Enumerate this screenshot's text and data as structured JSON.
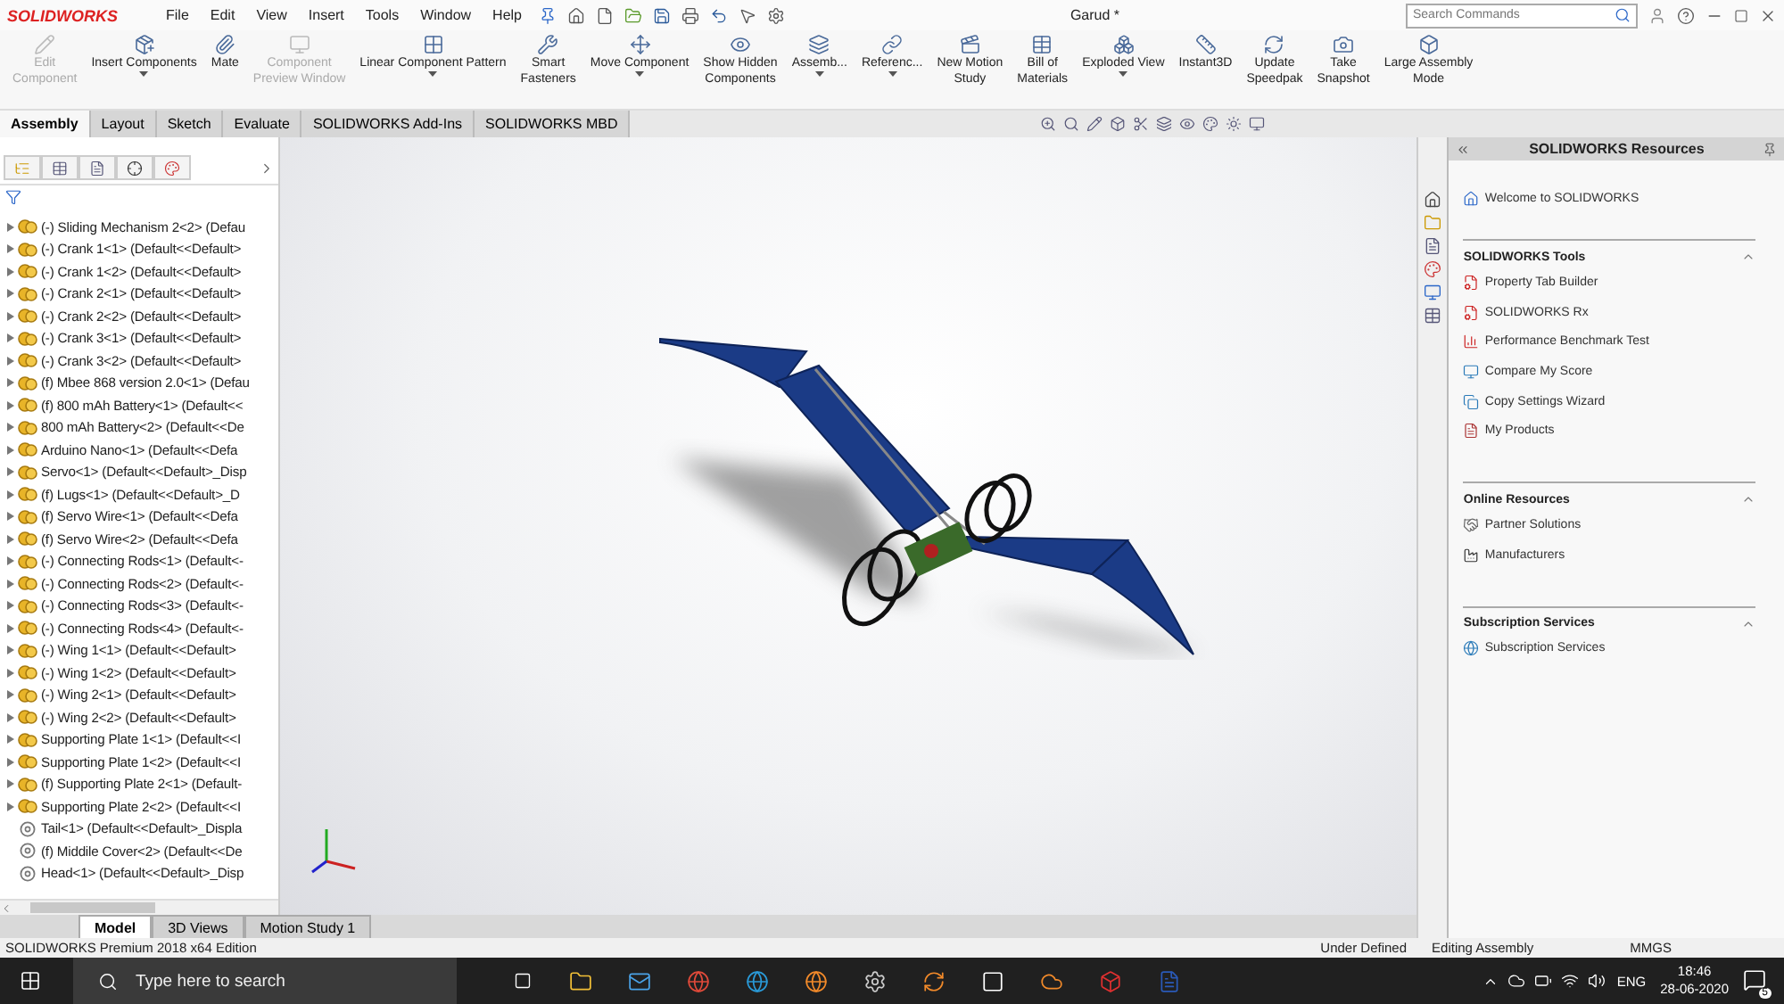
{
  "app": {
    "logo": "SOLIDWORKS",
    "menus": [
      "File",
      "Edit",
      "View",
      "Insert",
      "Tools",
      "Window",
      "Help"
    ],
    "title": "Garud *",
    "search": {
      "placeholder": "Search Commands"
    }
  },
  "ribbon": [
    {
      "lines": [
        "Edit",
        "Component"
      ],
      "disabled": true,
      "dropdown": false
    },
    {
      "lines": [
        "Insert Components"
      ],
      "disabled": false,
      "dropdown": true
    },
    {
      "lines": [
        "Mate"
      ],
      "disabled": false,
      "dropdown": false
    },
    {
      "lines": [
        "Component",
        "Preview Window"
      ],
      "disabled": true,
      "dropdown": false
    },
    {
      "lines": [
        "Linear Component Pattern"
      ],
      "disabled": false,
      "dropdown": true
    },
    {
      "lines": [
        "Smart",
        "Fasteners"
      ],
      "disabled": false,
      "dropdown": false
    },
    {
      "lines": [
        "Move Component"
      ],
      "disabled": false,
      "dropdown": true
    },
    {
      "lines": [
        "Show Hidden",
        "Components"
      ],
      "disabled": false,
      "dropdown": false
    },
    {
      "lines": [
        "Assemb..."
      ],
      "disabled": false,
      "dropdown": true
    },
    {
      "lines": [
        "Referenc..."
      ],
      "disabled": false,
      "dropdown": true
    },
    {
      "lines": [
        "New Motion",
        "Study"
      ],
      "disabled": false,
      "dropdown": false
    },
    {
      "lines": [
        "Bill of",
        "Materials"
      ],
      "disabled": false,
      "dropdown": false
    },
    {
      "lines": [
        "Exploded View"
      ],
      "disabled": false,
      "dropdown": true
    },
    {
      "lines": [
        "Instant3D"
      ],
      "disabled": false,
      "dropdown": false
    },
    {
      "lines": [
        "Update",
        "Speedpak"
      ],
      "disabled": false,
      "dropdown": false
    },
    {
      "lines": [
        "Take",
        "Snapshot"
      ],
      "disabled": false,
      "dropdown": false
    },
    {
      "lines": [
        "Large Assembly",
        "Mode"
      ],
      "disabled": false,
      "dropdown": false
    }
  ],
  "command_tabs": [
    {
      "label": "Assembly",
      "selected": true
    },
    {
      "label": "Layout",
      "selected": false
    },
    {
      "label": "Sketch",
      "selected": false
    },
    {
      "label": "Evaluate",
      "selected": false
    },
    {
      "label": "SOLIDWORKS Add-Ins",
      "selected": false
    },
    {
      "label": "SOLIDWORKS MBD",
      "selected": false
    }
  ],
  "feature_tree": {
    "items": [
      {
        "kind": "assembly",
        "label": "(-) Sliding Mechanism 2<2> (Defau"
      },
      {
        "kind": "assembly",
        "label": "(-) Crank 1<1> (Default<<Default>"
      },
      {
        "kind": "assembly",
        "label": "(-) Crank 1<2> (Default<<Default>"
      },
      {
        "kind": "assembly",
        "label": "(-) Crank 2<1> (Default<<Default>"
      },
      {
        "kind": "assembly",
        "label": "(-) Crank 2<2> (Default<<Default>"
      },
      {
        "kind": "assembly",
        "label": "(-) Crank 3<1> (Default<<Default>"
      },
      {
        "kind": "assembly",
        "label": "(-) Crank 3<2> (Default<<Default>"
      },
      {
        "kind": "assembly",
        "label": "(f) Mbee 868 version 2.0<1> (Defau"
      },
      {
        "kind": "assembly",
        "label": "(f) 800 mAh Battery<1> (Default<<"
      },
      {
        "kind": "assembly",
        "label": "800 mAh Battery<2> (Default<<De"
      },
      {
        "kind": "assembly",
        "label": "Arduino Nano<1> (Default<<Defa"
      },
      {
        "kind": "assembly",
        "label": "Servo<1> (Default<<Default>_Disp"
      },
      {
        "kind": "assembly",
        "label": "(f) Lugs<1> (Default<<Default>_D"
      },
      {
        "kind": "assembly",
        "label": "(f) Servo Wire<1> (Default<<Defa"
      },
      {
        "kind": "assembly",
        "label": "(f) Servo Wire<2> (Default<<Defa"
      },
      {
        "kind": "assembly",
        "label": "(-) Connecting Rods<1> (Default<-"
      },
      {
        "kind": "assembly",
        "label": "(-) Connecting Rods<2> (Default<-"
      },
      {
        "kind": "assembly",
        "label": "(-) Connecting Rods<3> (Default<-"
      },
      {
        "kind": "assembly",
        "label": "(-) Connecting Rods<4> (Default<-"
      },
      {
        "kind": "assembly",
        "label": "(-) Wing 1<1> (Default<<Default>"
      },
      {
        "kind": "assembly",
        "label": "(-) Wing 1<2> (Default<<Default>"
      },
      {
        "kind": "assembly",
        "label": "(-) Wing 2<1> (Default<<Default>"
      },
      {
        "kind": "assembly",
        "label": "(-) Wing 2<2> (Default<<Default>"
      },
      {
        "kind": "assembly",
        "label": "Supporting Plate 1<1> (Default<<I"
      },
      {
        "kind": "assembly",
        "label": "Supporting Plate 1<2> (Default<<I"
      },
      {
        "kind": "assembly",
        "label": "(f) Supporting Plate 2<1> (Default-"
      },
      {
        "kind": "assembly",
        "label": "Supporting Plate 2<2> (Default<<I"
      },
      {
        "kind": "part",
        "label": "Tail<1> (Default<<Default>_Displa"
      },
      {
        "kind": "part",
        "label": "(f) Middile Cover<2> (Default<<De"
      },
      {
        "kind": "part",
        "label": "Head<1> (Default<<Default>_Disp"
      }
    ]
  },
  "bottom_tabs": [
    {
      "label": "Model",
      "selected": true
    },
    {
      "label": "3D Views",
      "selected": false
    },
    {
      "label": "Motion Study 1",
      "selected": false
    }
  ],
  "resources": {
    "title": "SOLIDWORKS Resources",
    "welcome": "Welcome to SOLIDWORKS",
    "sections": [
      {
        "title": "SOLIDWORKS Tools",
        "items": [
          "Property Tab Builder",
          "SOLIDWORKS Rx",
          "Performance Benchmark Test",
          "Compare My Score",
          "Copy Settings Wizard",
          "My Products"
        ]
      },
      {
        "title": "Online Resources",
        "items": [
          "Partner Solutions",
          "Manufacturers"
        ]
      },
      {
        "title": "Subscription Services",
        "items": [
          "Subscription Services"
        ]
      }
    ]
  },
  "status_bar": {
    "edition": "SOLIDWORKS Premium 2018 x64 Edition",
    "state": "Under Defined",
    "mode": "Editing Assembly",
    "units": "MMGS"
  },
  "taskbar": {
    "search_placeholder": "Type here to search",
    "language": "ENG",
    "time": "18:46",
    "date": "28-06-2020",
    "notifications": "5"
  }
}
